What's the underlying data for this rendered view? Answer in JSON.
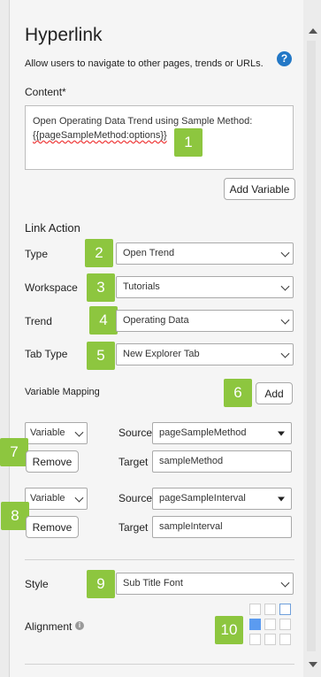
{
  "panel": {
    "title": "Hyperlink",
    "help_icon": "?",
    "description": "Allow users to navigate to other pages, trends or URLs."
  },
  "content": {
    "label": "Content*",
    "line1": "Open Operating Data Trend using Sample Method:",
    "line2": "{{pageSampleMethod:options}}",
    "add_variable_label": "Add Variable"
  },
  "link_action": {
    "title": "Link Action",
    "type_label": "Type",
    "type_value": "Open Trend",
    "workspace_label": "Workspace",
    "workspace_value": "Tutorials",
    "trend_label": "Trend",
    "trend_value": "Operating Data",
    "tab_type_label": "Tab Type",
    "tab_type_value": "New Explorer Tab",
    "variable_mapping_label": "Variable Mapping",
    "add_label": "Add"
  },
  "mappings": [
    {
      "kind": "Variable",
      "source_label": "Source",
      "source_value": "pageSampleMethod",
      "target_label": "Target",
      "target_value": "sampleMethod",
      "remove_label": "Remove"
    },
    {
      "kind": "Variable",
      "source_label": "Source",
      "source_value": "pageSampleInterval",
      "target_label": "Target",
      "target_value": "sampleInterval",
      "remove_label": "Remove"
    }
  ],
  "style": {
    "style_label": "Style",
    "style_value": "Sub Title Font",
    "alignment_label": "Alignment",
    "info_icon": "i",
    "selected_alignment": "middle-left"
  },
  "badges": [
    "1",
    "2",
    "3",
    "4",
    "5",
    "6",
    "7",
    "8",
    "9",
    "10"
  ],
  "colors": {
    "badge": "#8dc63f",
    "help": "#2378c6",
    "alignment_active": "#5b9bf0"
  }
}
